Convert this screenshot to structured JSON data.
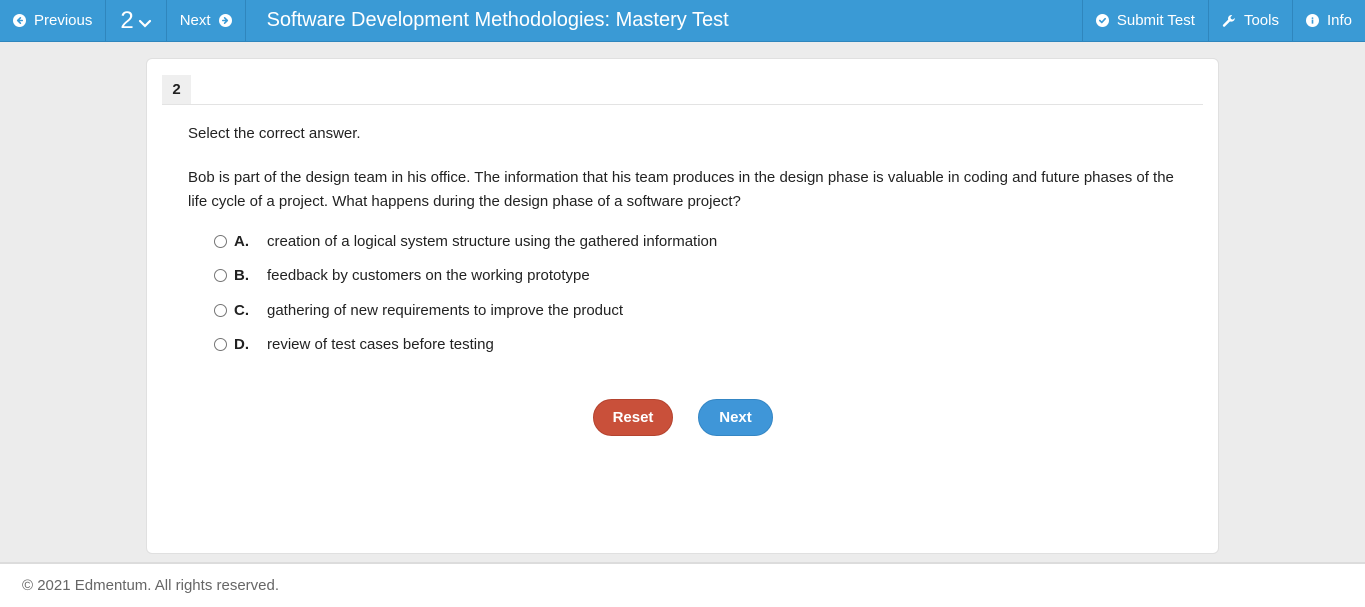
{
  "topbar": {
    "previous_label": "Previous",
    "question_number": "2",
    "next_label": "Next",
    "title": "Software Development Methodologies: Mastery Test",
    "submit_label": "Submit Test",
    "tools_label": "Tools",
    "info_label": "Info",
    "bg_color": "#3a9ad5"
  },
  "question": {
    "number": "2",
    "instruction": "Select the correct answer.",
    "prompt": "Bob is part of the design team in his office. The information that his team produces in the design phase is valuable in coding and future phases of the life cycle of a project. What happens during the design phase of a software project?",
    "choices": [
      {
        "letter": "A.",
        "text": "creation of a logical system structure using the gathered information",
        "selected": false
      },
      {
        "letter": "B.",
        "text": "feedback by customers on the working prototype",
        "selected": false
      },
      {
        "letter": "C.",
        "text": "gathering of new requirements to improve the product",
        "selected": false
      },
      {
        "letter": "D.",
        "text": "review of test cases before testing",
        "selected": false
      }
    ]
  },
  "actions": {
    "reset_label": "Reset",
    "next_label": "Next",
    "reset_color": "#c9503a",
    "next_color": "#3f96d8"
  },
  "footer": {
    "copyright": "© 2021 Edmentum. All rights reserved."
  },
  "icons": {
    "previous": "arrow-circle-left-icon",
    "question_dropdown": "chevron-down-icon",
    "next": "arrow-circle-right-icon",
    "submit": "check-circle-icon",
    "tools": "wrench-icon",
    "info": "info-circle-icon"
  }
}
